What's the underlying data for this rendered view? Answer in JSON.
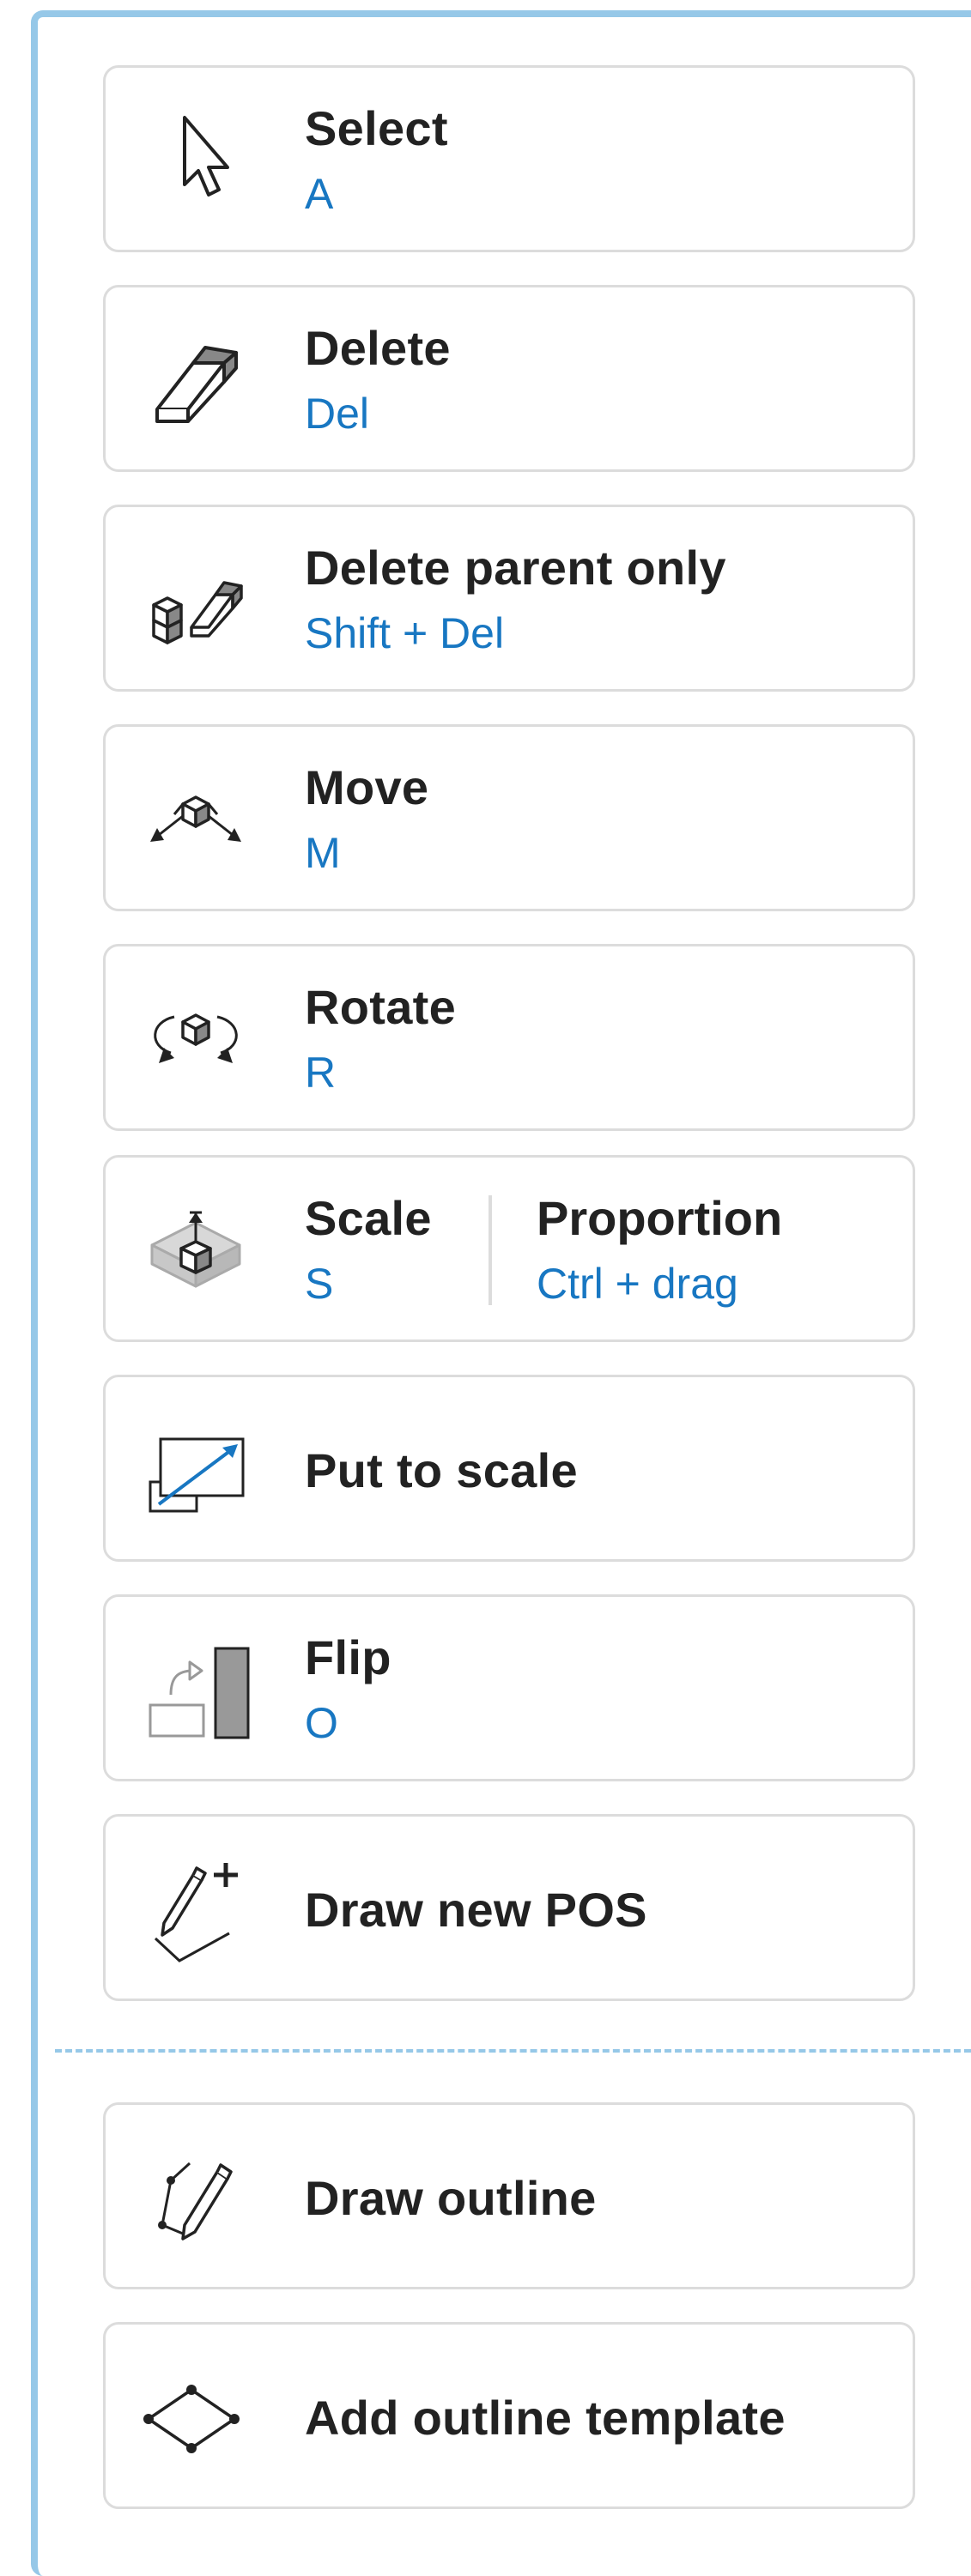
{
  "tools": [
    {
      "title": "Select",
      "shortcut": "A",
      "icon": "cursor-arrow-icon"
    },
    {
      "title": "Delete",
      "shortcut": "Del",
      "icon": "eraser-icon"
    },
    {
      "title": "Delete parent only",
      "shortcut": "Shift + Del",
      "icon": "delete-parent-icon"
    },
    {
      "title": "Move",
      "shortcut": "M",
      "icon": "move-cube-icon"
    },
    {
      "title": "Rotate",
      "shortcut": "R",
      "icon": "rotate-cube-icon"
    },
    {
      "title": "Scale",
      "shortcut": "S",
      "secondary_title": "Proportion",
      "secondary_shortcut": "Ctrl + drag",
      "icon": "scale-cube-icon"
    },
    {
      "title": "Put to scale",
      "icon": "put-to-scale-icon"
    },
    {
      "title": "Flip",
      "shortcut": "O",
      "icon": "flip-icon"
    },
    {
      "title": "Draw new POS",
      "icon": "draw-new-pos-icon"
    }
  ],
  "outline_tools": [
    {
      "title": "Draw outline",
      "icon": "draw-outline-icon"
    },
    {
      "title": "Add outline template",
      "icon": "outline-template-icon"
    }
  ],
  "colors": {
    "panel_border": "#96c8e8",
    "shortcut_text": "#1877c2",
    "title_text": "#222222",
    "card_border": "#dcdcdc"
  }
}
